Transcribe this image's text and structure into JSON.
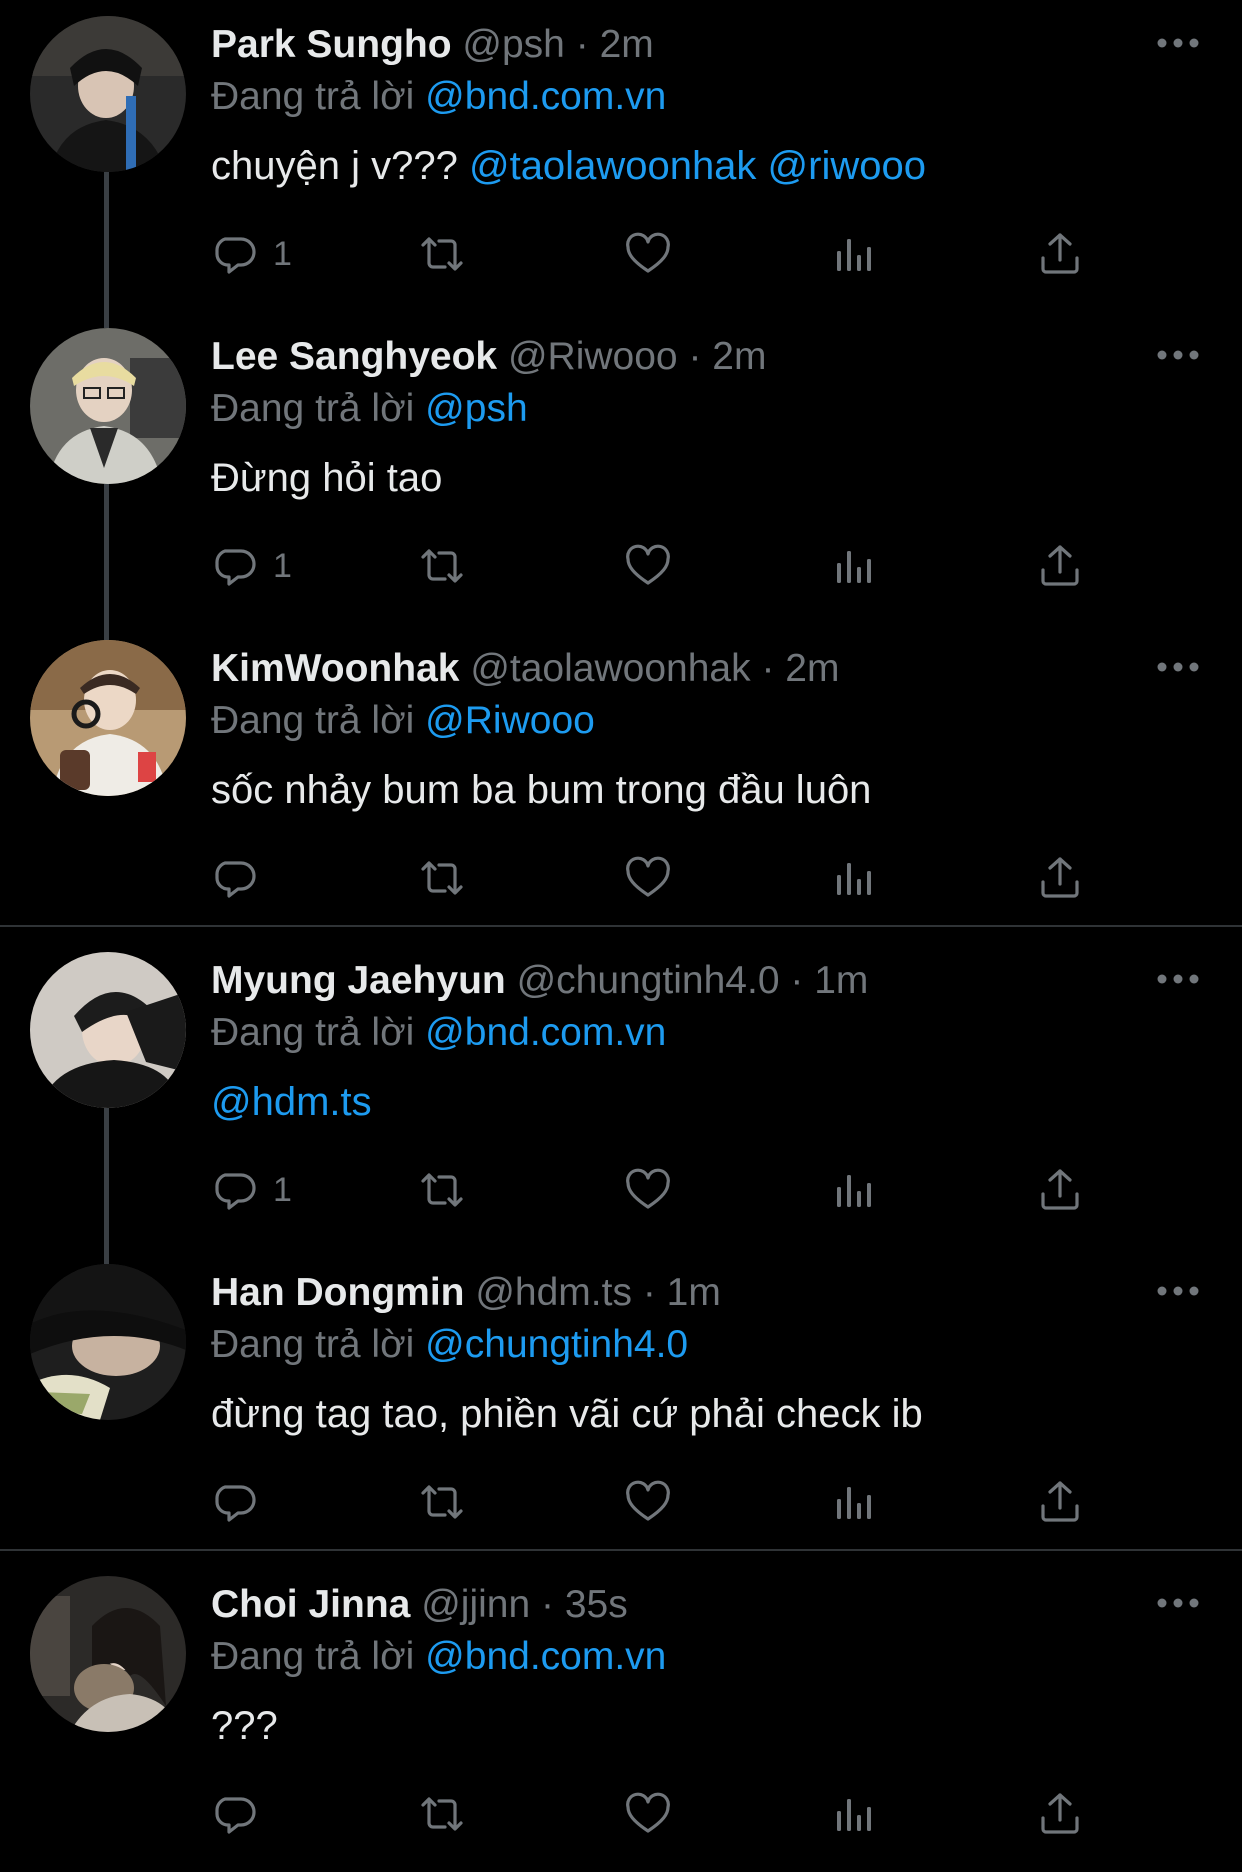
{
  "colors": {
    "background": "#000000",
    "text": "#e7e9ea",
    "muted": "#71767b",
    "link": "#1d9bf0",
    "separator": "#2f3336",
    "thread_line": "#3a3f44"
  },
  "reply_prefix": "Đang trả lời",
  "tweets": [
    {
      "name": "Park Sungho",
      "handle": "@psh",
      "dot": "·",
      "time": "2m",
      "reply_to": "@bnd.com.vn",
      "text": "chuyện j v???",
      "mentions": "@taolawoonhak @riwooo",
      "reply_count": "1",
      "avatar_icon": "avatar-photo-park-sungho"
    },
    {
      "name": "Lee Sanghyeok",
      "handle": "@Riwooo",
      "dot": "·",
      "time": "2m",
      "reply_to": "@psh",
      "text": "Đừng hỏi tao",
      "mentions": "",
      "reply_count": "1",
      "avatar_icon": "avatar-photo-lee-sanghyeok"
    },
    {
      "name": "KimWoonhak",
      "handle": "@taolawoonhak",
      "dot": "·",
      "time": "2m",
      "reply_to": "@Riwooo",
      "text": "sốc nhảy bum ba bum trong đầu luôn",
      "mentions": "",
      "reply_count": "",
      "avatar_icon": "avatar-photo-kimwoonhak"
    },
    {
      "name": "Myung Jaehyun",
      "handle": "@chungtinh4.0",
      "dot": "·",
      "time": "1m",
      "reply_to": "@bnd.com.vn",
      "text": "",
      "mentions": "@hdm.ts",
      "reply_count": "1",
      "avatar_icon": "avatar-photo-myung-jaehyun"
    },
    {
      "name": "Han Dongmin",
      "handle": "@hdm.ts",
      "dot": "·",
      "time": "1m",
      "reply_to": "@chungtinh4.0",
      "text": "đừng tag tao, phiền vãi cứ phải check ib",
      "mentions": "",
      "reply_count": "",
      "avatar_icon": "avatar-photo-han-dongmin"
    },
    {
      "name": "Choi Jinna",
      "handle": "@jjinn",
      "dot": "·",
      "time": "35s",
      "reply_to": "@bnd.com.vn",
      "text": "???",
      "mentions": "",
      "reply_count": "",
      "avatar_icon": "avatar-photo-choi-jinna"
    }
  ],
  "icons": {
    "reply": "reply-icon",
    "retweet": "retweet-icon",
    "like": "like-icon",
    "views": "views-icon",
    "share": "share-icon",
    "more": "more-icon"
  }
}
